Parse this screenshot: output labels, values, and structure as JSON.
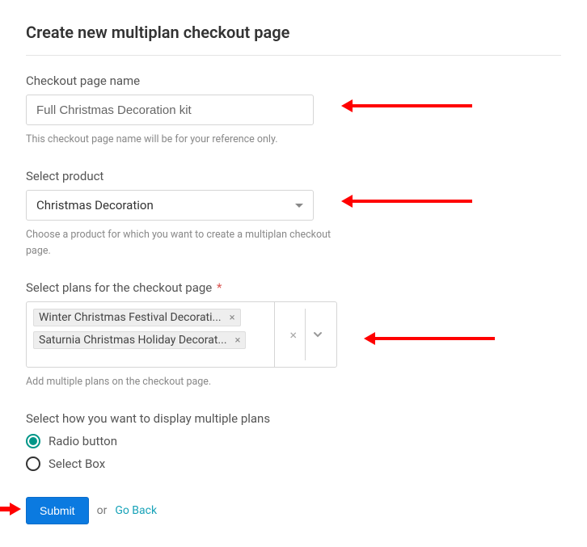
{
  "page": {
    "title": "Create new multiplan checkout page"
  },
  "fields": {
    "name": {
      "label": "Checkout page name",
      "value": "Full Christmas Decoration kit",
      "help": "This checkout page name will be for your reference only."
    },
    "product": {
      "label": "Select product",
      "selected": "Christmas Decoration",
      "help": "Choose a product for which you want to create a multiplan checkout page."
    },
    "plans": {
      "label": "Select plans for the checkout page",
      "required_mark": "*",
      "chips": [
        "Winter Christmas Festival Decorati...",
        "Saturnia Christmas Holiday Decorat..."
      ],
      "help": "Add multiple plans on the checkout page."
    },
    "display": {
      "label": "Select how you want to display multiple plans",
      "options": [
        "Radio button",
        "Select Box"
      ],
      "selected_index": 0
    }
  },
  "actions": {
    "submit": "Submit",
    "or": "or",
    "goback": "Go Back"
  }
}
